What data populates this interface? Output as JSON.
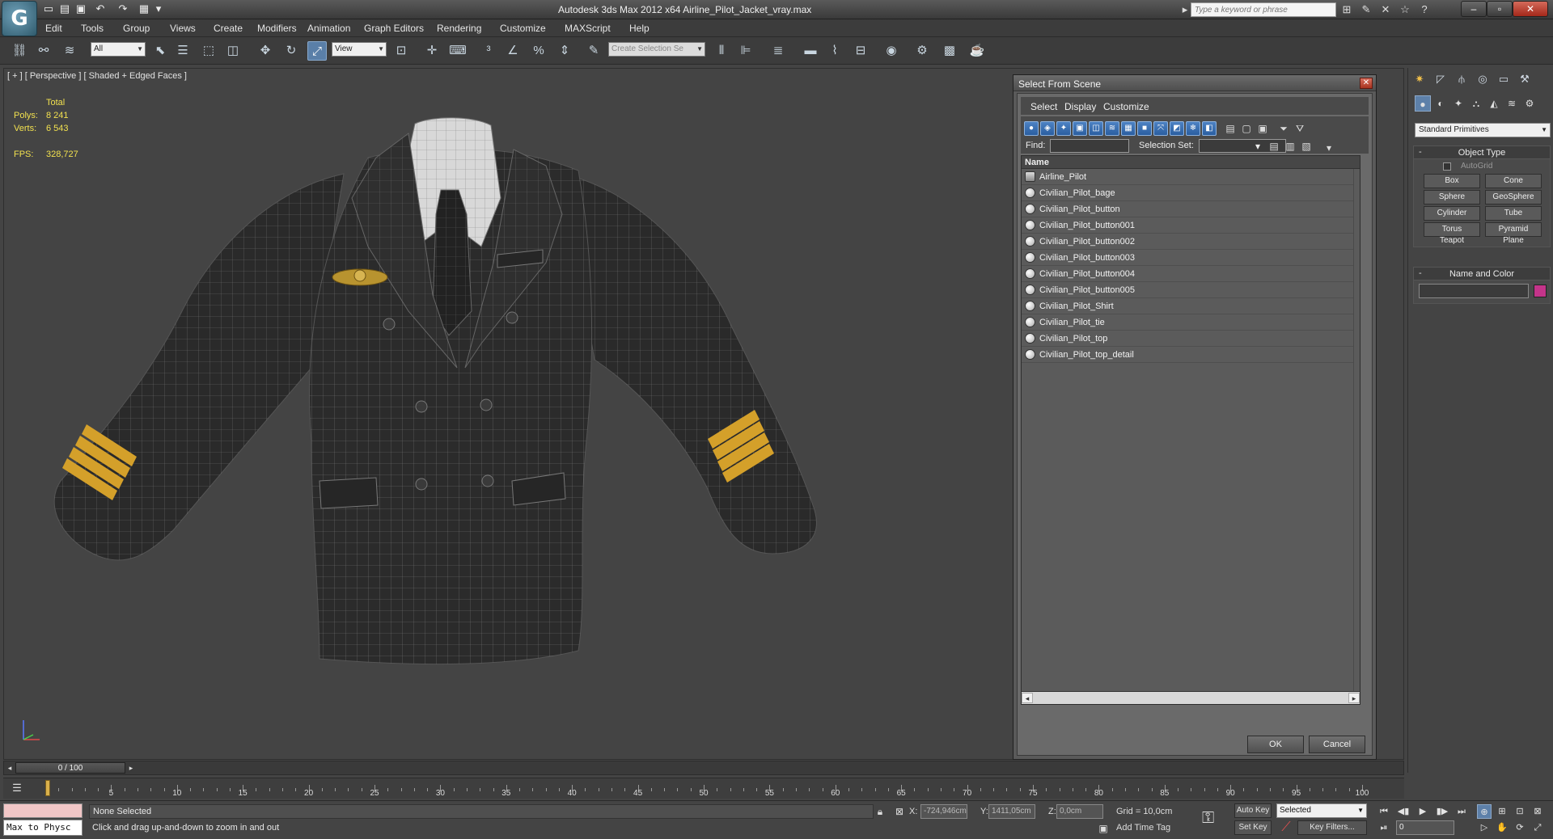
{
  "window": {
    "title": "Autodesk 3ds Max  2012 x64      Airline_Pilot_Jacket_vray.max",
    "search_placeholder": "Type a keyword or phrase"
  },
  "menu": [
    "Edit",
    "Tools",
    "Group",
    "Views",
    "Create",
    "Modifiers",
    "Animation",
    "Graph Editors",
    "Rendering",
    "Customize",
    "MAXScript",
    "Help"
  ],
  "toolbar": {
    "selection_filter": "All",
    "reference_coord": "View",
    "named_selection_placeholder": "Create Selection Se"
  },
  "viewport": {
    "label": "[ + ] [ Perspective ] [ Shaded + Edged Faces ]",
    "stats": {
      "header": "Total",
      "polys_label": "Polys:",
      "polys": "8 241",
      "verts_label": "Verts:",
      "verts": "6 543",
      "fps_label": "FPS:",
      "fps": "328,727"
    }
  },
  "dialog": {
    "title": "Select From Scene",
    "menus": [
      "Select",
      "Display",
      "Customize"
    ],
    "find_label": "Find:",
    "selection_set_label": "Selection Set:",
    "column_name": "Name",
    "objects": [
      {
        "name": "Airline_Pilot",
        "type": "group"
      },
      {
        "name": "Civilian_Pilot_bage",
        "type": "geometry"
      },
      {
        "name": "Civilian_Pilot_button",
        "type": "geometry"
      },
      {
        "name": "Civilian_Pilot_button001",
        "type": "geometry"
      },
      {
        "name": "Civilian_Pilot_button002",
        "type": "geometry"
      },
      {
        "name": "Civilian_Pilot_button003",
        "type": "geometry"
      },
      {
        "name": "Civilian_Pilot_button004",
        "type": "geometry"
      },
      {
        "name": "Civilian_Pilot_button005",
        "type": "geometry"
      },
      {
        "name": "Civilian_Pilot_Shirt",
        "type": "geometry"
      },
      {
        "name": "Civilian_Pilot_tie",
        "type": "geometry"
      },
      {
        "name": "Civilian_Pilot_top",
        "type": "geometry"
      },
      {
        "name": "Civilian_Pilot_top_detail",
        "type": "geometry"
      }
    ],
    "ok_label": "OK",
    "cancel_label": "Cancel"
  },
  "command_panel": {
    "category": "Standard Primitives",
    "object_type_title": "Object Type",
    "autogrid_label": "AutoGrid",
    "primitives": [
      "Box",
      "Cone",
      "Sphere",
      "GeoSphere",
      "Cylinder",
      "Tube",
      "Torus",
      "Pyramid",
      "Teapot",
      "Plane"
    ],
    "name_color_title": "Name and Color",
    "object_color": "#c4348a"
  },
  "timeline": {
    "frame_readout": "0 / 100",
    "ticks": [
      "5",
      "10",
      "15",
      "20",
      "25",
      "30",
      "35",
      "40",
      "45",
      "50",
      "55",
      "60",
      "65",
      "70",
      "75",
      "80",
      "85",
      "90",
      "95",
      "100"
    ]
  },
  "status": {
    "listener_text": "Max to Physc",
    "selection": "None Selected",
    "prompt": "Click and drag up-and-down to zoom in and out",
    "x_label": "X:",
    "x_value": "-724,946cm",
    "y_label": "Y:",
    "y_value": "1411,05cm",
    "z_label": "Z:",
    "z_value": "0,0cm",
    "grid": "Grid = 10,0cm",
    "add_time_tag": "Add Time Tag",
    "auto_key": "Auto Key",
    "set_key": "Set Key",
    "key_mode": "Selected",
    "key_filters": "Key Filters...",
    "current_frame": "0"
  }
}
